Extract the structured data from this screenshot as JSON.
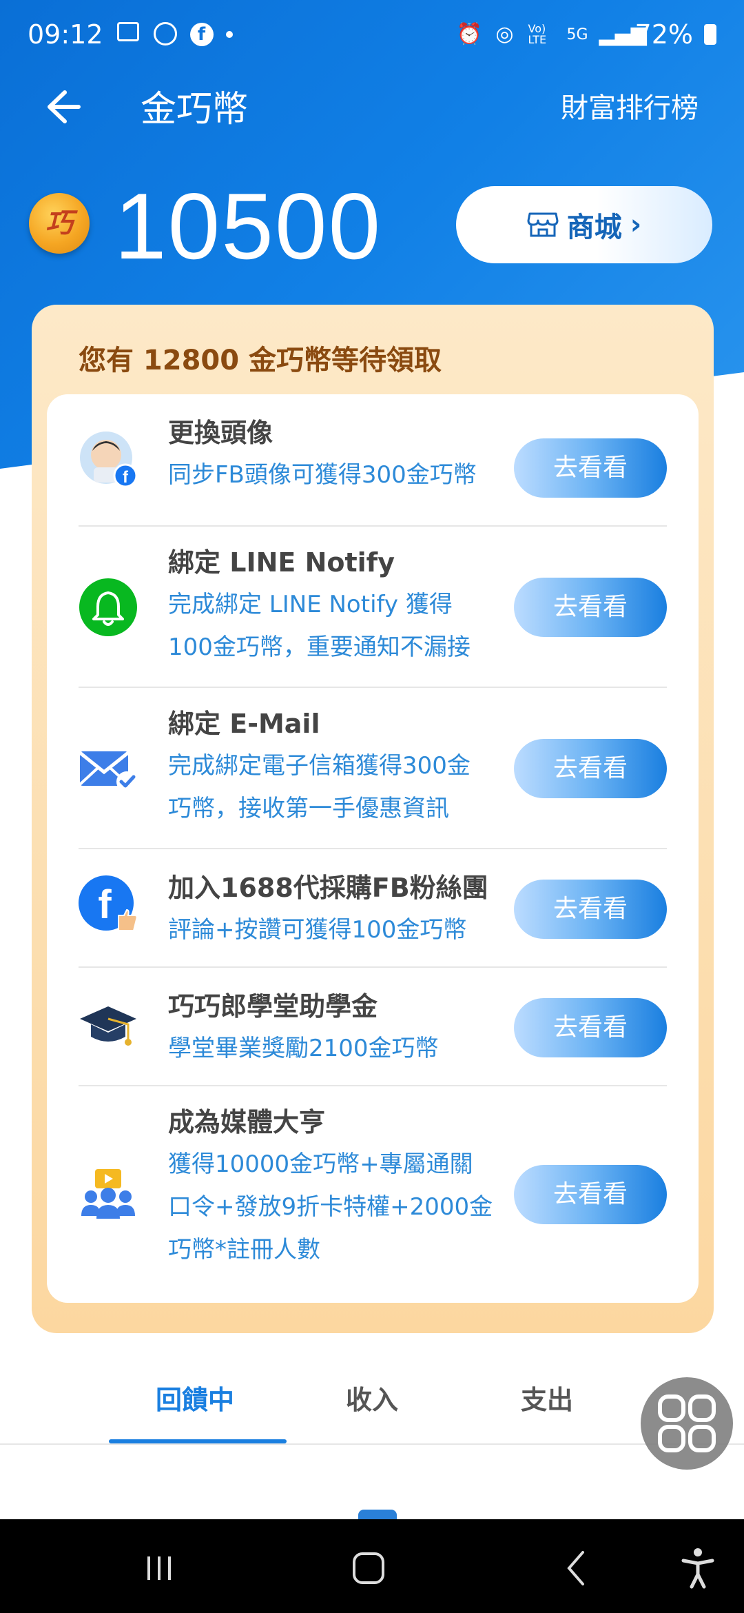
{
  "status_bar": {
    "time": "09:12",
    "battery": "72%",
    "network": "5G",
    "volte": "Vo) LTE"
  },
  "header": {
    "title": "金巧幣",
    "ranking_label": "財富排行榜"
  },
  "balance": {
    "amount": "10500",
    "coin_glyph": "巧",
    "mall_label": "商城"
  },
  "pending": {
    "title": "您有 12800 金巧幣等待領取",
    "tasks": [
      {
        "title": "更換頭像",
        "desc": [
          "同步FB頭像可獲得300金巧幣"
        ],
        "button": "去看看",
        "icon": "avatar-facebook-icon"
      },
      {
        "title": "綁定 LINE Notify",
        "desc": [
          "完成綁定 LINE Notify 獲得",
          "100金巧幣，重要通知不漏接"
        ],
        "button": "去看看",
        "icon": "bell-icon"
      },
      {
        "title": "綁定 E-Mail",
        "desc": [
          "完成綁定電子信箱獲得300金",
          "巧幣，接收第一手優惠資訊"
        ],
        "button": "去看看",
        "icon": "mail-check-icon"
      },
      {
        "title": "加入1688代採購FB粉絲團",
        "desc": [
          "評論+按讚可獲得100金巧幣"
        ],
        "button": "去看看",
        "icon": "facebook-like-icon"
      },
      {
        "title": "巧巧郎學堂助學金",
        "desc": [
          "學堂畢業獎勵2100金巧幣"
        ],
        "button": "去看看",
        "icon": "graduation-cap-icon"
      },
      {
        "title": "成為媒體大亨",
        "desc": [
          "獲得10000金巧幣+專屬通關",
          "口令+發放9折卡特權+2000金",
          "巧幣*註冊人數"
        ],
        "button": "去看看",
        "icon": "media-group-icon"
      }
    ]
  },
  "tabs": [
    {
      "label": "回饋中",
      "active": true
    },
    {
      "label": "收入",
      "active": false
    },
    {
      "label": "支出",
      "active": false
    }
  ],
  "colors": {
    "header_blue": "#1180e6",
    "accent_blue": "#1a7fe0",
    "card_orange": "#fcd7a0",
    "title_brown": "#8a4a10"
  }
}
